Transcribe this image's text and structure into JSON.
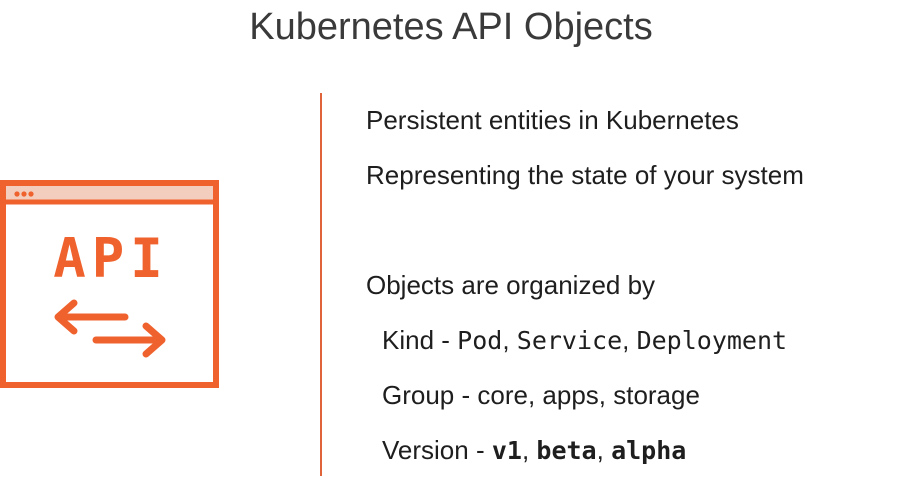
{
  "title": "Kubernetes API Objects",
  "icon": {
    "name": "api-window-icon",
    "label": "API",
    "color": "#f0622d"
  },
  "bullets": {
    "persistent": "Persistent entities in Kubernetes",
    "representing": "Representing the state of your system",
    "organized": "Objects are organized by"
  },
  "kind": {
    "label": "Kind - ",
    "items": [
      "Pod",
      "Service",
      "Deployment"
    ],
    "sep": ", "
  },
  "group": {
    "text": "Group - core, apps, storage"
  },
  "version": {
    "label": "Version - ",
    "items": [
      "v1",
      "beta",
      "alpha"
    ],
    "sep": ", "
  },
  "accent_color": "#e0643a"
}
